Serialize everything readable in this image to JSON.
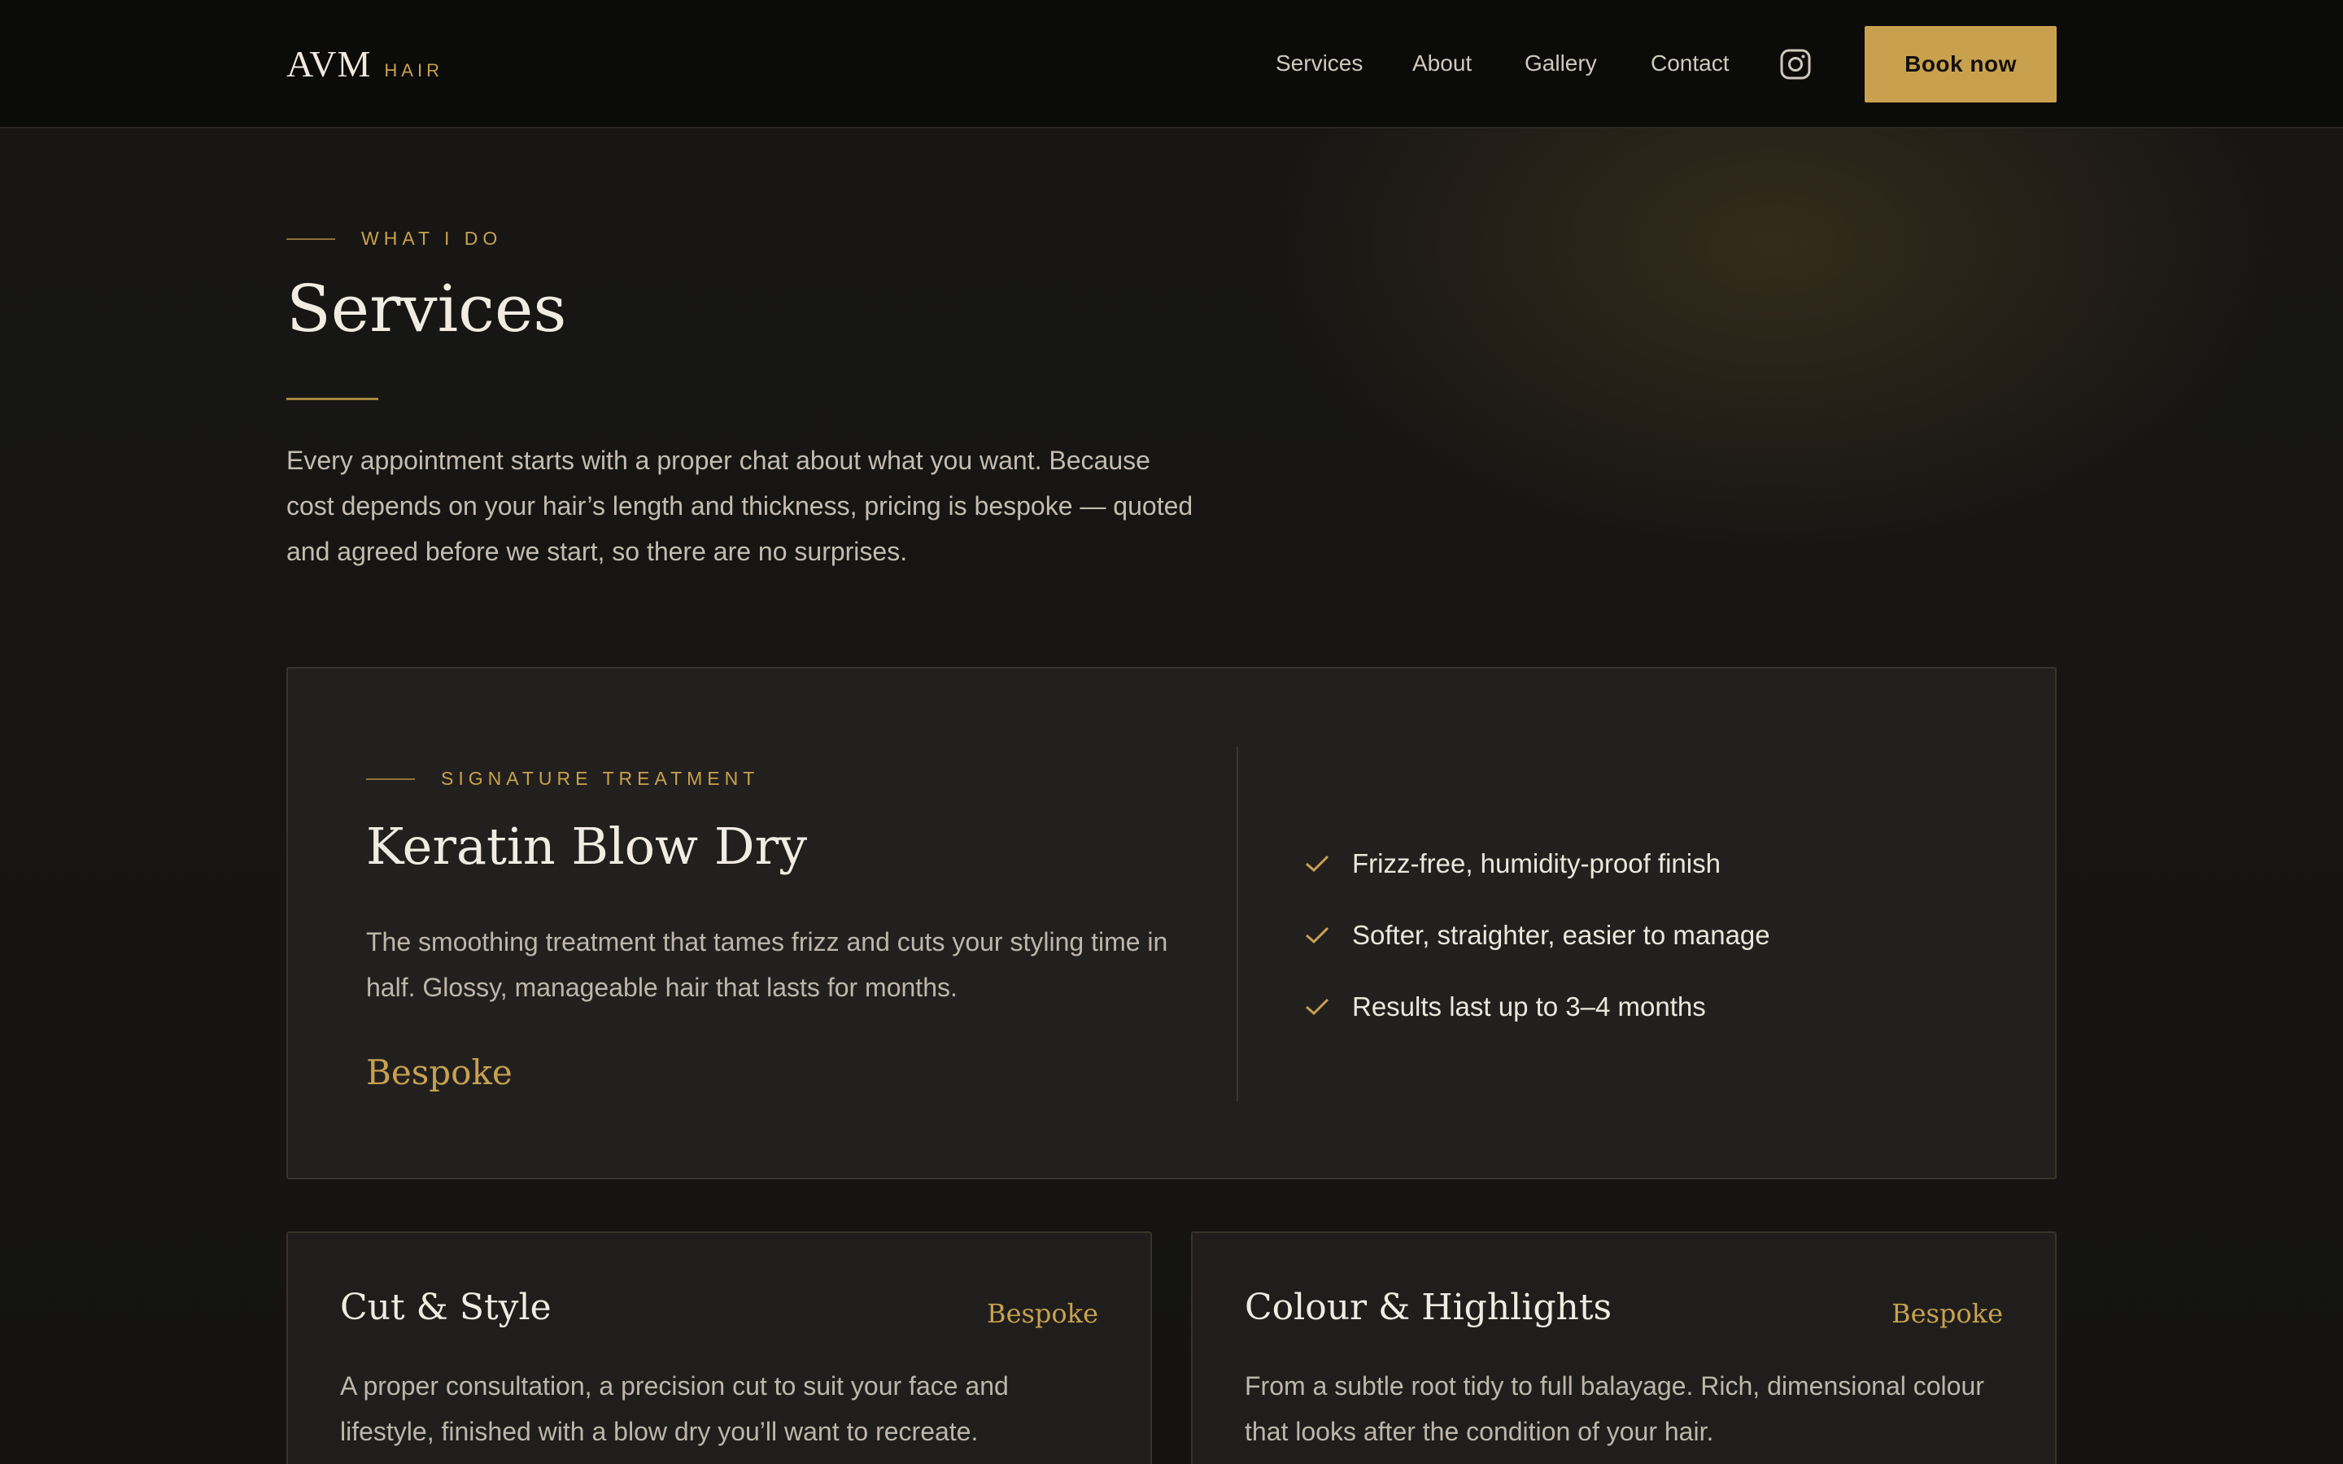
{
  "header": {
    "logo_main": "AVM",
    "logo_sub": "HAIR",
    "nav": [
      "Services",
      "About",
      "Gallery",
      "Contact"
    ],
    "instagram_icon": "instagram-icon",
    "book_label": "Book now"
  },
  "intro": {
    "eyebrow": "WHAT I DO",
    "title": "Services",
    "text": "Every appointment starts with a proper chat about what you want. Because cost depends on your hair’s length and thickness, pricing is bespoke — quoted and agreed before we start, so there are no surprises."
  },
  "signature": {
    "eyebrow": "SIGNATURE TREATMENT",
    "title": "Keratin Blow Dry",
    "description": "The smoothing treatment that tames frizz and cuts your styling time in half. Glossy, manageable hair that lasts for months.",
    "price": "Bespoke",
    "benefits": [
      "Frizz-free, humidity-proof finish",
      "Softer, straighter, easier to manage",
      "Results last up to 3–4 months"
    ]
  },
  "services": [
    {
      "title": "Cut & Style",
      "price": "Bespoke",
      "description": "A proper consultation, a precision cut to suit your face and lifestyle, finished with a blow dry you’ll want to recreate."
    },
    {
      "title": "Colour & Highlights",
      "price": "Bespoke",
      "description": "From a subtle root tidy to full balayage. Rich, dimensional colour that looks after the condition of your hair."
    }
  ],
  "colors": {
    "accent": "#c9a14e",
    "background": "#141312",
    "header_bg": "#0b0b0a"
  }
}
